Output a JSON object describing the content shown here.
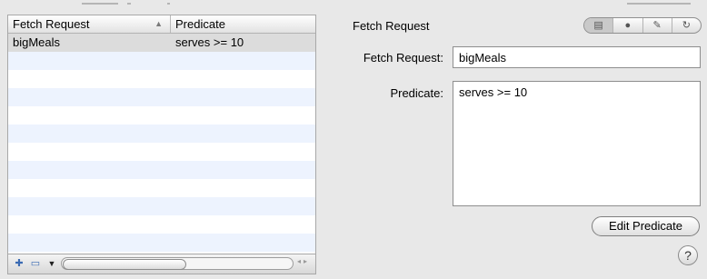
{
  "table": {
    "columns": [
      {
        "label": "Fetch Request",
        "sort_indicator": "▲"
      },
      {
        "label": "Predicate"
      }
    ],
    "rows": [
      {
        "name": "bigMeals",
        "predicate": "serves >= 10"
      }
    ],
    "empty_rows": 12,
    "toolbar": {
      "add_icon": "plus-icon",
      "remove_icon": "minus-icon",
      "menu_icon": "chevron-down-icon"
    }
  },
  "inspector": {
    "title": "Fetch Request",
    "tabs": [
      "general-icon",
      "person-icon",
      "wrench-icon",
      "refresh-icon"
    ],
    "fetch_label": "Fetch Request:",
    "fetch_value": "bigMeals",
    "predicate_label": "Predicate:",
    "predicate_value": "serves >= 10",
    "edit_button": "Edit Predicate",
    "help": "?"
  }
}
